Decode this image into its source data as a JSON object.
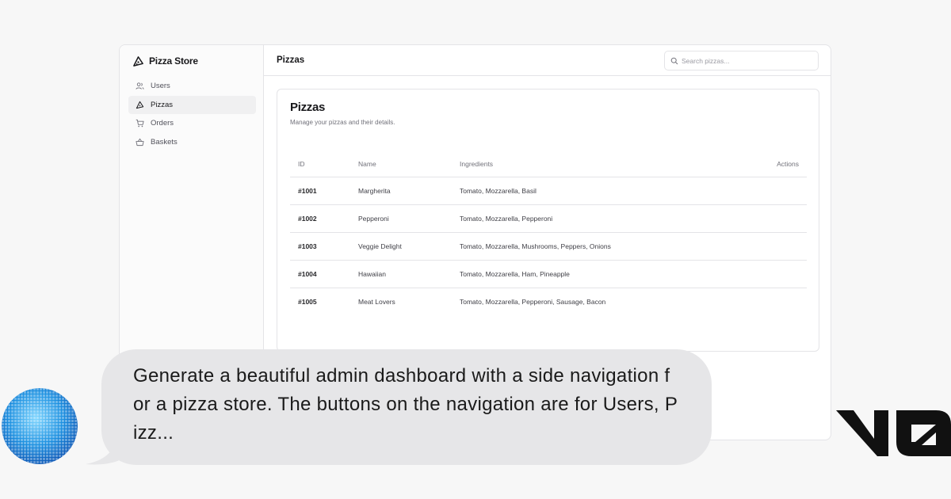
{
  "app": {
    "brand": "Pizza Store",
    "page_title": "Pizzas"
  },
  "sidebar": {
    "items": [
      {
        "label": "Users",
        "icon": "users-icon"
      },
      {
        "label": "Pizzas",
        "icon": "pizza-icon"
      },
      {
        "label": "Orders",
        "icon": "cart-icon"
      },
      {
        "label": "Baskets",
        "icon": "basket-icon"
      }
    ]
  },
  "search": {
    "placeholder": "Search pizzas..."
  },
  "card": {
    "title": "Pizzas",
    "subtitle": "Manage your pizzas and their details."
  },
  "table": {
    "headers": {
      "id": "ID",
      "name": "Name",
      "ingredients": "Ingredients",
      "actions": "Actions"
    },
    "rows": [
      {
        "id": "#1001",
        "name": "Margherita",
        "ingredients": "Tomato, Mozzarella, Basil"
      },
      {
        "id": "#1002",
        "name": "Pepperoni",
        "ingredients": "Tomato, Mozzarella, Pepperoni"
      },
      {
        "id": "#1003",
        "name": "Veggie Delight",
        "ingredients": "Tomato, Mozzarella, Mushrooms, Peppers, Onions"
      },
      {
        "id": "#1004",
        "name": "Hawaiian",
        "ingredients": "Tomato, Mozzarella, Ham, Pineapple"
      },
      {
        "id": "#1005",
        "name": "Meat Lovers",
        "ingredients": "Tomato, Mozzarella, Pepperoni, Sausage, Bacon"
      }
    ]
  },
  "prompt": {
    "text": "Generate a beautiful admin dashboard with a side navigation for a pizza store. The buttons on the navigation are for Users, Pizz..."
  },
  "colors": {
    "bubble": "#e6e6e8",
    "border": "#e4e4e7",
    "avatar_blue": "#1a8fe0"
  }
}
